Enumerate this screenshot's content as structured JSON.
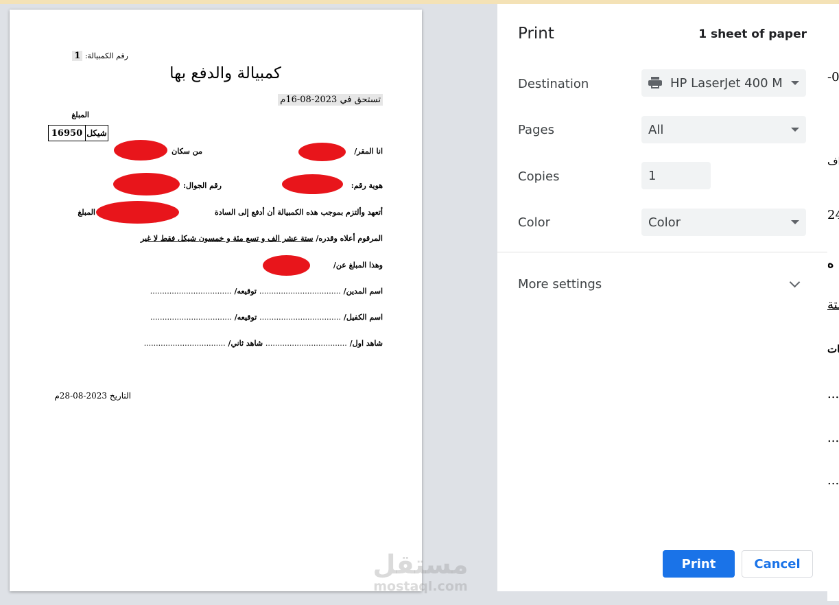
{
  "doc": {
    "number_label": "رقم الكمبيالة:",
    "number_value": "1",
    "title": "كمبيالة والدفع بها",
    "due": "تستحق في 2023-08-16م",
    "amount_label": "المبلغ",
    "amount_value": "16950",
    "currency": "شيكل",
    "row1_right": "انا المقر/",
    "row1_left": "من سكان",
    "row2_right": "هوية رقم:",
    "row2_left": "رقم الجوال:",
    "pledge_start": "أتعهد وألتزم بموجب هذه الكمبيالة أن أدفع إلى السادة",
    "pledge_end": "المبلغ",
    "amount_words_prefix": "المرقوم أعلاه وقدره/",
    "amount_words": "ستة عشر الف و تسع مئة و خمسون شيكل فقط لا غير",
    "amount_for": "وهذا المبلغ عن/",
    "debtor_label": "اسم المدين/",
    "debtor_dots": "..................................",
    "sign_label": "توقيعه/",
    "sign_dots": "..................................",
    "guarantor_label": "اسم الكفيل/",
    "guarantor_dots": "..................................",
    "sign2_label": "توقيعه/",
    "sign2_dots": "..................................",
    "witness1_label": "شاهد اول/",
    "witness1_dots": "..................................",
    "witness2_label": "شاهد ثاني/",
    "witness2_dots": "..................................",
    "date": "التاريخ 2023-08-28م"
  },
  "watermark": {
    "arabic": "مستقل",
    "latin": "mostaql.com"
  },
  "print_panel": {
    "title": "Print",
    "sheets": "1 sheet of paper",
    "destination_label": "Destination",
    "destination_value": "HP LaserJet 400 M",
    "destination_icon": "printer-icon",
    "pages_label": "Pages",
    "pages_value": "All",
    "copies_label": "Copies",
    "copies_value": "1",
    "color_label": "Color",
    "color_value": "Color",
    "more_settings": "More settings",
    "print_button": "Print",
    "cancel_button": "Cancel",
    "accent_color": "#1a73e8"
  },
  "right_edge": {
    "l1": "-0",
    "l2": "اف",
    "l3": "24",
    "l4": "ه",
    "l5": "ستة",
    "l6": "فات",
    "l7": "...",
    "l8": "...",
    "l9": "..."
  }
}
